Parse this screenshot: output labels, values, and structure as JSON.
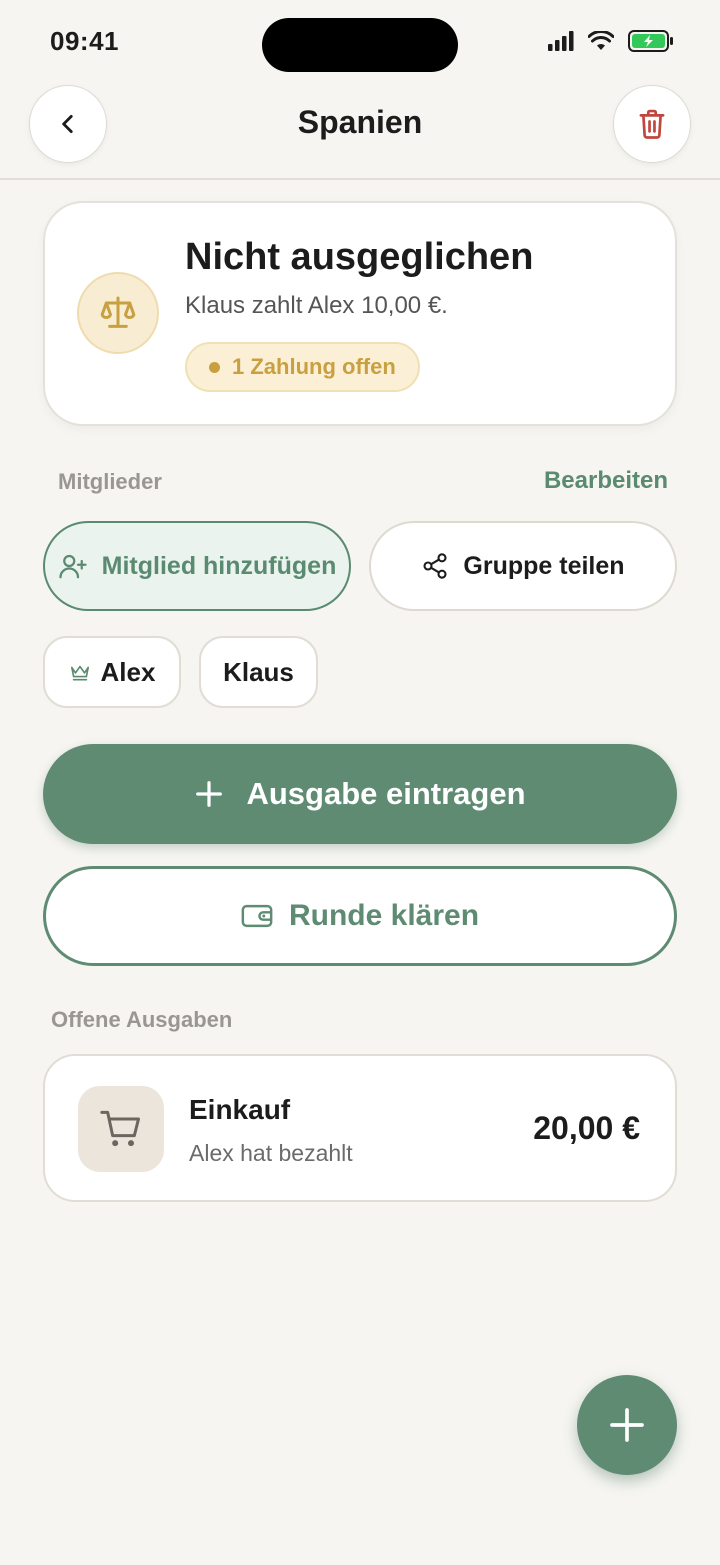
{
  "status_bar": {
    "time": "09:41"
  },
  "header": {
    "title": "Spanien"
  },
  "balance": {
    "title": "Nicht ausgeglichen",
    "subtitle": "Klaus zahlt Alex 10,00 €.",
    "badge": "1 Zahlung offen"
  },
  "members": {
    "label": "Mitglieder",
    "edit_label": "Bearbeiten",
    "add_label": "Mitglied hinzufügen",
    "share_label": "Gruppe teilen",
    "list": [
      "Alex",
      "Klaus"
    ]
  },
  "actions": {
    "add_expense": "Ausgabe eintragen",
    "settle_round": "Runde klären"
  },
  "open_expenses": {
    "label": "Offene Ausgaben",
    "items": [
      {
        "name": "Einkauf",
        "payer": "Alex hat bezahlt",
        "amount": "20,00 €"
      }
    ]
  },
  "colors": {
    "accent": "#5e8b72",
    "warning": "#c9a040",
    "danger": "#c0473f",
    "background": "#f6f5f1"
  },
  "icons": [
    "back-icon",
    "trash-icon",
    "scale-icon",
    "add-user-icon",
    "share-icon",
    "crown-icon",
    "plus-icon",
    "wallet-icon",
    "cart-icon"
  ]
}
